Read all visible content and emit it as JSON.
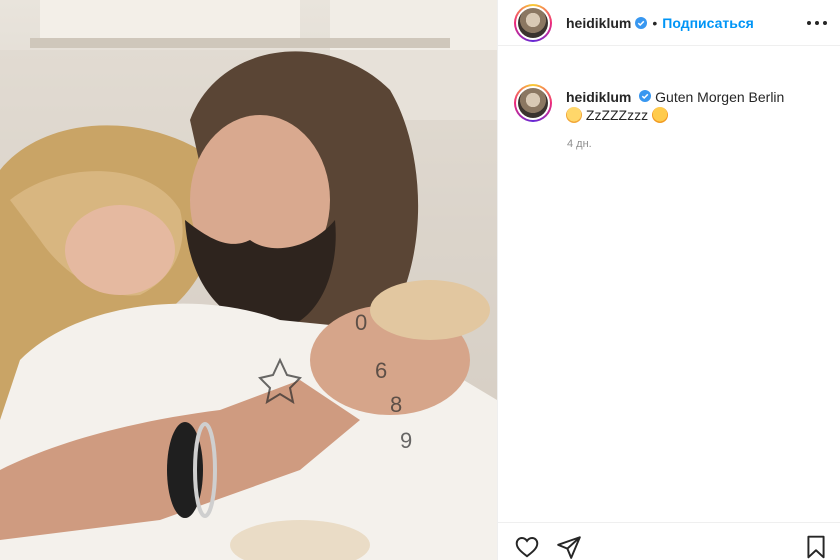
{
  "post": {
    "username": "heidiklum",
    "follow_label": "Подписаться",
    "separator": "•",
    "caption_text": "Guten Morgen Berlin",
    "caption_line2": "ZzZZZzzz",
    "timestamp": "4 дн."
  },
  "icons": {
    "verified": "verified-badge-icon",
    "more": "more-options-icon",
    "like": "heart-icon",
    "share": "paper-plane-icon",
    "save": "bookmark-icon",
    "emoji1": "sleeping-face-emoji",
    "emoji2": "smiling-hearts-emoji"
  },
  "colors": {
    "accent": "#0095f6",
    "verified": "#3897f0",
    "text": "#262626",
    "muted": "#8e8e8e"
  }
}
